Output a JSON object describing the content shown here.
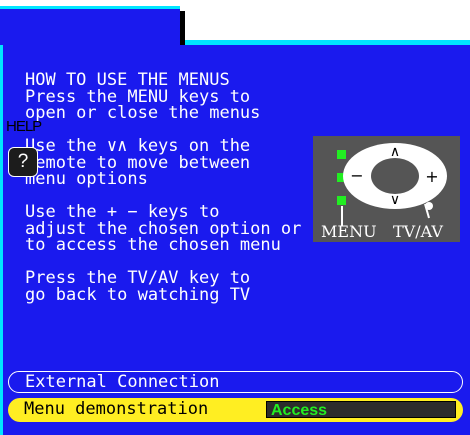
{
  "help": {
    "label": "HELP",
    "icon_glyph": "?",
    "lines": [
      "HOW TO USE THE MENUS",
      "Press the MENU keys to",
      "open or close the menus",
      "",
      "Use the ∨∧ keys on the",
      "remote to move between",
      "menu options",
      "",
      "Use the + − keys to",
      "adjust the chosen option or",
      "to access the chosen menu",
      "",
      "Press the TV/AV key to",
      "go back to watching TV"
    ]
  },
  "remote": {
    "menu_label": "MENU",
    "tvav_label": "TV/AV",
    "up_glyph": "∧",
    "down_glyph": "∨",
    "minus_glyph": "−",
    "plus_glyph": "+"
  },
  "menu": {
    "items": [
      {
        "label": "External Connection"
      },
      {
        "label": "Menu demonstration",
        "value": "Access"
      }
    ]
  },
  "colors": {
    "panel": "#1a1aee",
    "accent": "#00e5ff",
    "highlight": "#ffee22",
    "value_text": "#22ee22"
  }
}
